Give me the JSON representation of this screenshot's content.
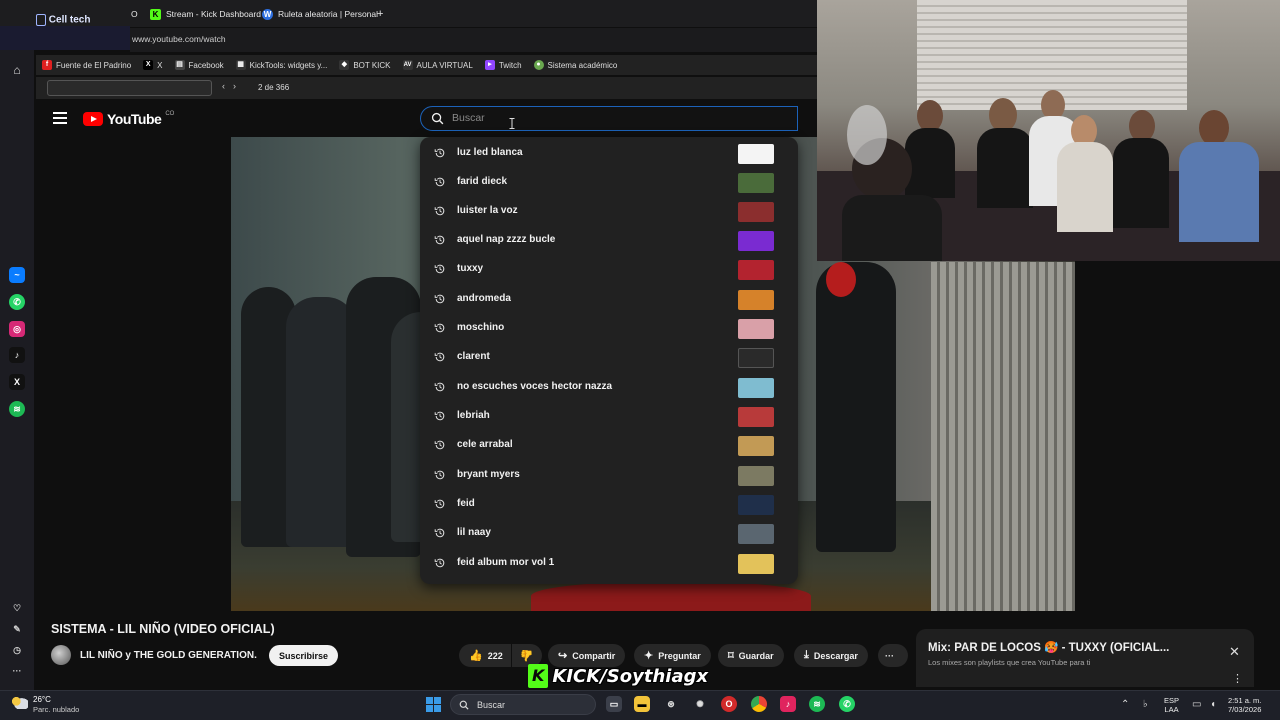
{
  "browser": {
    "brand": "Cell tech",
    "tabs": [
      {
        "label": "O",
        "icon": "tab-fragment-icon"
      },
      {
        "label": "Stream - Kick Dashboard",
        "icon": "kick-icon"
      },
      {
        "label": "Ruleta aleatoria | Personal",
        "icon": "wheel-icon"
      }
    ],
    "new_tab": "+",
    "url": "www.youtube.com/watch",
    "bookmarks": [
      {
        "label": "Fuente de El Padrino",
        "icon": "f",
        "color": "#e02020"
      },
      {
        "label": "X",
        "icon": "X",
        "color": "#000000"
      },
      {
        "label": "Facebook",
        "icon": "▤",
        "color": "#444444"
      },
      {
        "label": "KickTools: widgets y...",
        "icon": "▦",
        "color": "#333333"
      },
      {
        "label": "BOT KICK",
        "icon": "◆",
        "color": "#333333"
      },
      {
        "label": "AULA VIRTUAL",
        "icon": "AV",
        "color": "#333333"
      },
      {
        "label": "Twitch",
        "icon": "▸",
        "color": "#9146ff"
      },
      {
        "label": "Sistema académico",
        "icon": "●",
        "color": "#6aa84f"
      }
    ],
    "find": {
      "prev": "‹",
      "next": "›",
      "count": "2 de 366"
    }
  },
  "youtube": {
    "logo_text": "YouTube",
    "logo_country": "CO",
    "search": {
      "placeholder": "Buscar",
      "value": ""
    },
    "suggestions": [
      {
        "label": "luz led blanca",
        "thumb": "#f4f4f4"
      },
      {
        "label": "farid dieck",
        "thumb": "#4a6b3a"
      },
      {
        "label": "luister la voz",
        "thumb": "#8b2e2e"
      },
      {
        "label": "aquel nap zzzz bucle",
        "thumb": "#7a2bd1"
      },
      {
        "label": "tuxxy",
        "thumb": "#b3232f"
      },
      {
        "label": "andromeda",
        "thumb": "#d6822a"
      },
      {
        "label": "moschino",
        "thumb": "#d9a0a8"
      },
      {
        "label": "clarent",
        "thumb": "#2a2a2a"
      },
      {
        "label": "no escuches voces hector nazza",
        "thumb": "#7fbcd0"
      },
      {
        "label": "lebriah",
        "thumb": "#b83a3a"
      },
      {
        "label": "cele arrabal",
        "thumb": "#c29a55"
      },
      {
        "label": "bryant myers",
        "thumb": "#7c7a62"
      },
      {
        "label": "feid",
        "thumb": "#1f2f4a"
      },
      {
        "label": "lil naay",
        "thumb": "#5a6670"
      },
      {
        "label": "feid album mor vol 1",
        "thumb": "#e3c25a"
      }
    ],
    "video": {
      "title": "SISTEMA - LIL NIÑO (VIDEO OFICIAL)",
      "channel": "LIL NIÑO y THE GOLD GENERATION.",
      "subscribe": "Suscribirse",
      "likes": "222",
      "share": "Compartir",
      "ask": "Preguntar",
      "save": "Guardar",
      "download": "Descargar",
      "more": "···"
    },
    "mix": {
      "title": "Mix: PAR DE LOCOS 🥵 - TUXXY (OFICIAL...",
      "subtitle": "Los mixes son playlists que crea YouTube para ti",
      "close": "✕",
      "more": "⋮"
    }
  },
  "overlay": {
    "kick_badge": "K",
    "handle_prefix": "KICK",
    "handle": "/Soythiagx"
  },
  "taskbar": {
    "temperature": "26°C",
    "weather": "Parc. nublado",
    "search": "Buscar",
    "lang": "ESP",
    "region": "LAA",
    "time": "2:51 a. m.",
    "date": "7/03/2026"
  },
  "colors": {
    "accent": "#1c62b9",
    "youtube_red": "#ff0000",
    "kick_green": "#53fc18",
    "background": "#0f0f0f"
  }
}
